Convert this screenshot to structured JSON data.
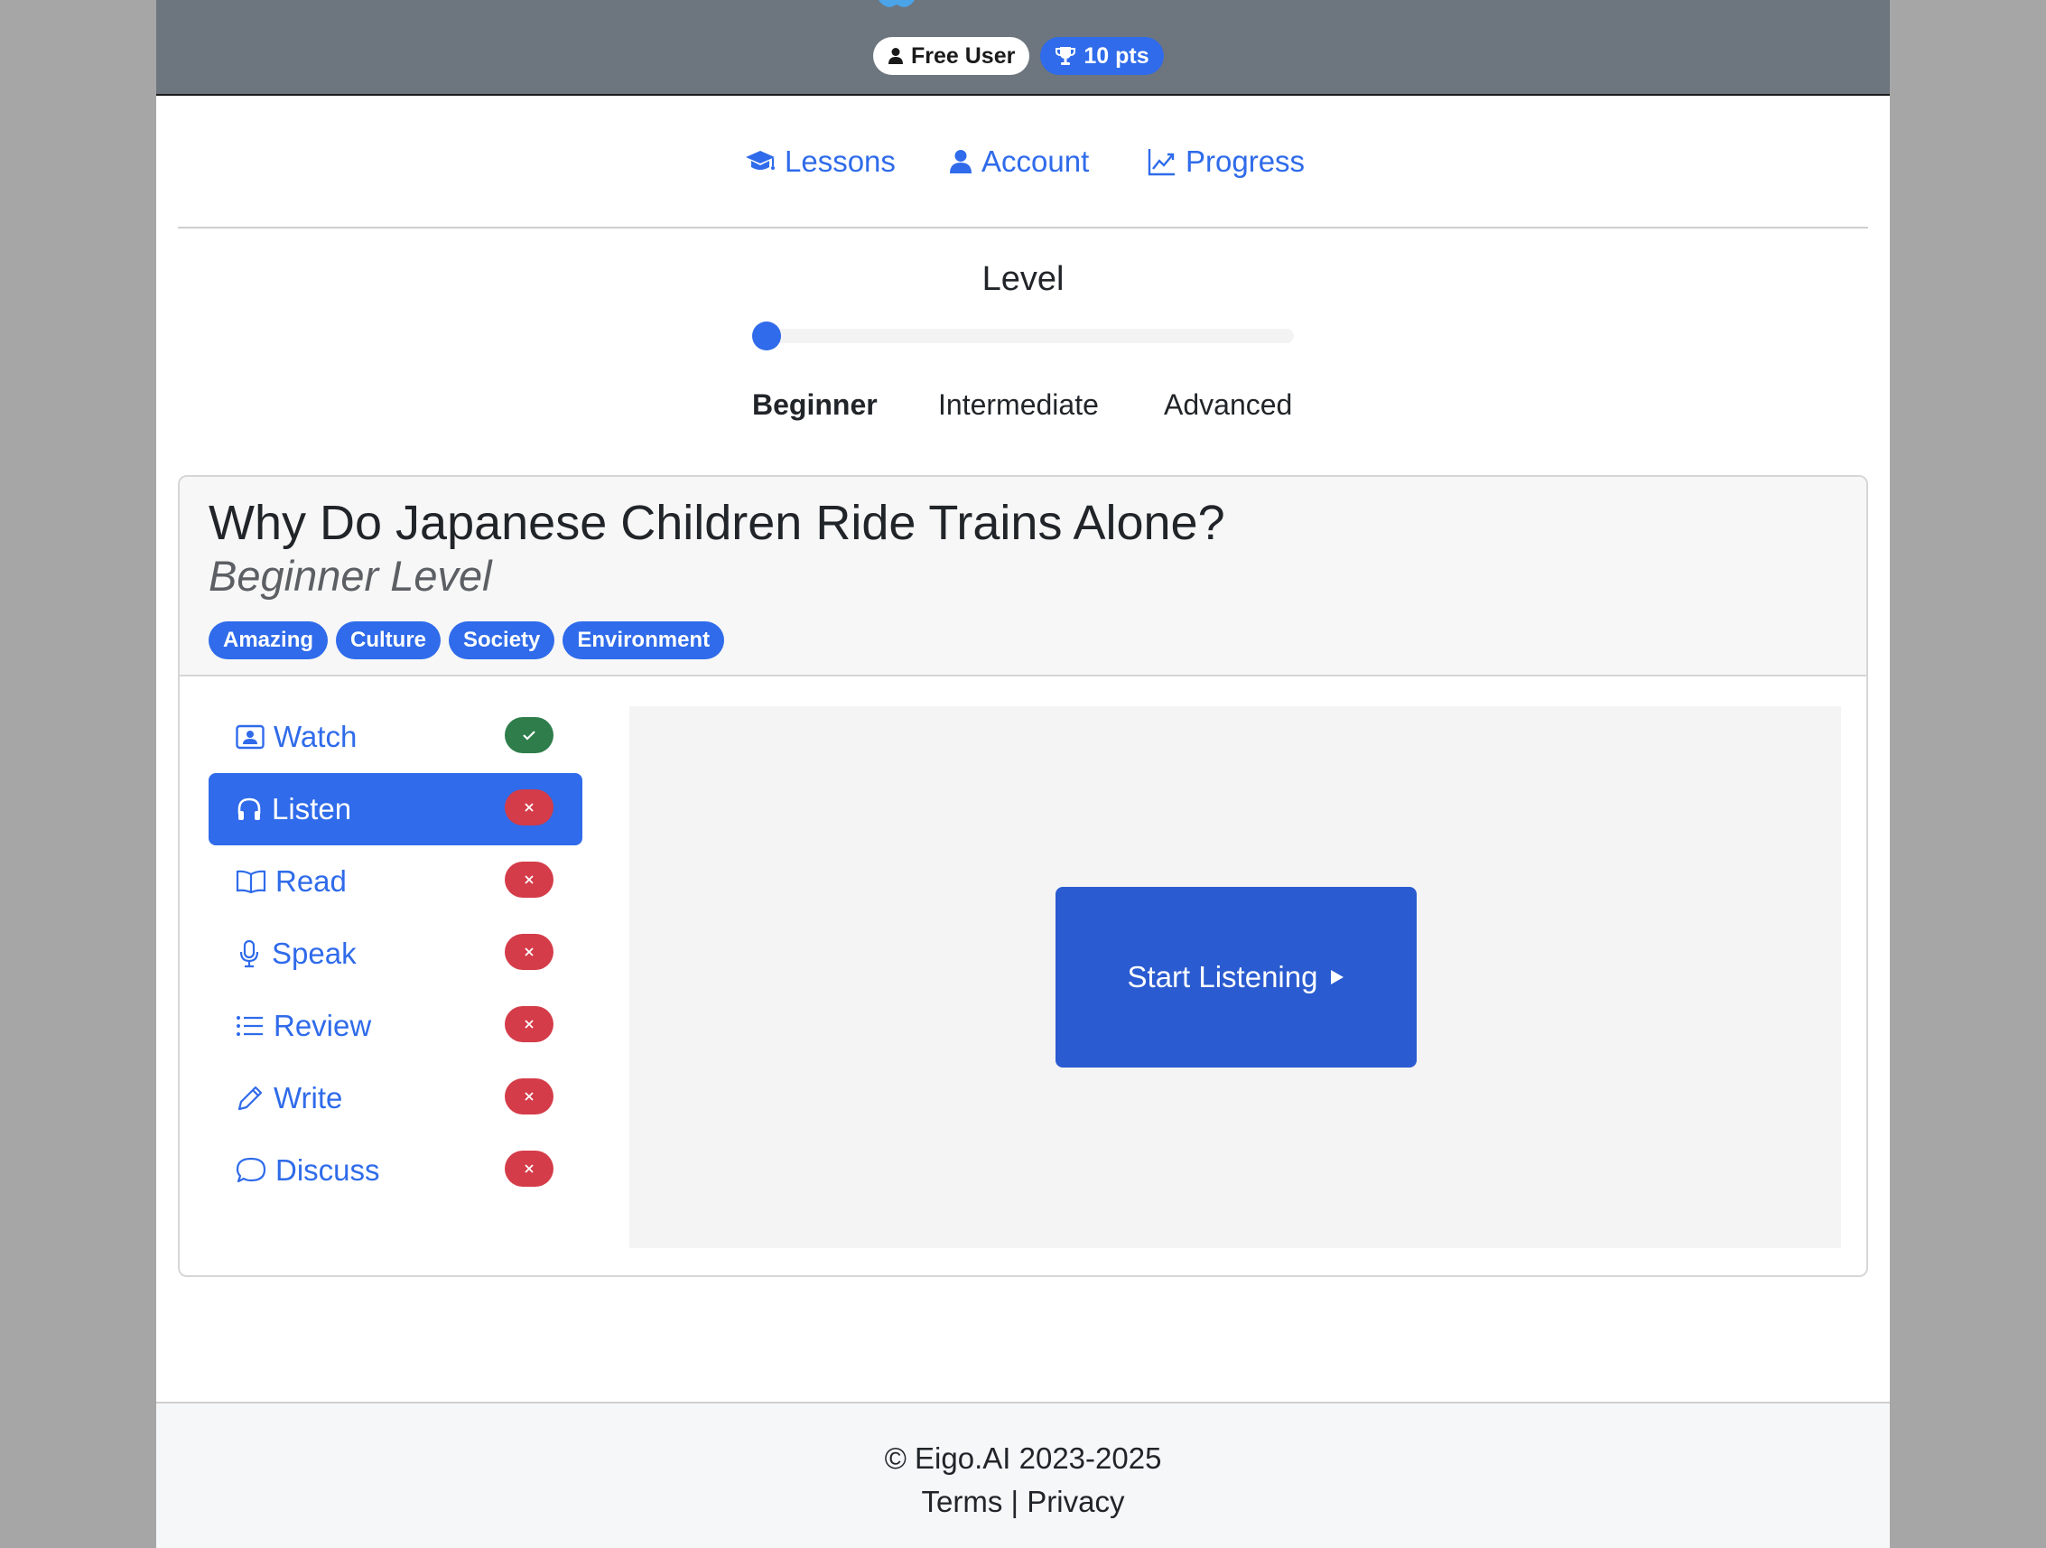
{
  "header": {
    "user_badge": "Free User",
    "points_badge": "10 pts"
  },
  "nav": {
    "lessons": "Lessons",
    "account": "Account",
    "progress": "Progress"
  },
  "level": {
    "title": "Level",
    "value": 0,
    "options": [
      "Beginner",
      "Intermediate",
      "Advanced"
    ],
    "selected": "Beginner"
  },
  "lesson": {
    "title": "Why Do Japanese Children Ride Trains Alone?",
    "level_label": "Beginner Level",
    "tags": [
      "Amazing",
      "Culture",
      "Society",
      "Environment"
    ]
  },
  "activities": [
    {
      "label": "Watch",
      "icon": "video-person-icon",
      "status": "complete"
    },
    {
      "label": "Listen",
      "icon": "headphones-icon",
      "status": "incomplete",
      "active": true
    },
    {
      "label": "Read",
      "icon": "book-icon",
      "status": "incomplete"
    },
    {
      "label": "Speak",
      "icon": "microphone-icon",
      "status": "incomplete"
    },
    {
      "label": "Review",
      "icon": "list-icon",
      "status": "incomplete"
    },
    {
      "label": "Write",
      "icon": "pencil-icon",
      "status": "incomplete"
    },
    {
      "label": "Discuss",
      "icon": "chat-bubble-icon",
      "status": "incomplete"
    }
  ],
  "stage": {
    "start_button": "Start Listening"
  },
  "footer": {
    "copyright": "© Eigo.AI 2023-2025",
    "terms": "Terms",
    "separator": "|",
    "privacy": "Privacy"
  },
  "colors": {
    "primary": "#2f6bea",
    "header_bg": "#6d757e",
    "complete": "#2e7d4b",
    "incomplete": "#d43c49"
  }
}
